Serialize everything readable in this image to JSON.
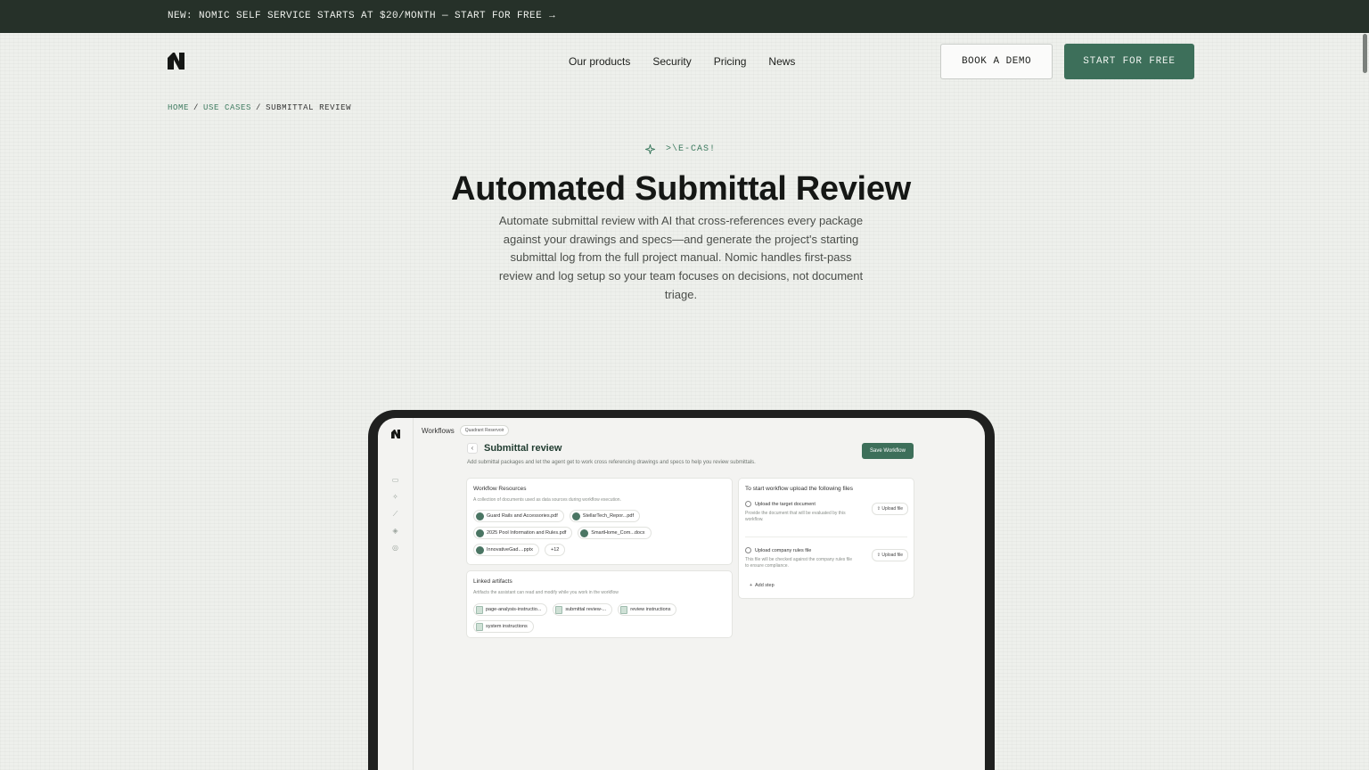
{
  "banner": {
    "text": "NEW: NOMIC SELF SERVICE STARTS AT $20/MONTH — START FOR FREE",
    "arrow": "→"
  },
  "nav": {
    "logo": "nomic-logo",
    "links": [
      "Our products",
      "Security",
      "Pricing",
      "News"
    ],
    "book_demo": "BOOK A DEMO",
    "start_free": "START FOR FREE"
  },
  "breadcrumb": {
    "home": "HOME",
    "sep": "/",
    "use_cases": "USE CASES",
    "current": "SUBMITTAL REVIEW"
  },
  "hero": {
    "eyebrow": ">\\E-CAS!",
    "title": "Automated Submittal Review",
    "subtitle": "Automate submittal review with AI that cross-references every package against your drawings and specs—and generate the project's starting submittal log from the full project manual. Nomic handles first-pass review and log setup so your team focuses on decisions, not document triage."
  },
  "app": {
    "section": "Workflows",
    "org_pill": "Quadrant Reservoir",
    "page_title": "Submittal review",
    "page_desc": "Add submittal packages and let the agent get to work cross referencing drawings and specs to help you review submittals.",
    "save_button": "Save Workflow",
    "resources": {
      "title": "Workflow Resources",
      "desc": "A collection of documents used as data sources during workflow execution.",
      "files": [
        "Guard Rails and Accessories.pdf",
        "StellarTech_Repor...pdf",
        "2025 Pool Information and Rules.pdf",
        "SmartHome_Com...docx",
        "InnovativeGad....pptx"
      ],
      "more": "+12"
    },
    "artifacts": {
      "title": "Linked artifacts",
      "desc": "Artifacts the assistant can read and modify while you work in the workflow",
      "items": [
        "page-analysis-instructio...",
        "submittal review-...",
        "review instructions",
        "system instructions"
      ]
    },
    "start": {
      "title": "To start workflow upload the following files",
      "step1_title": "Upload the target document",
      "step1_desc": "Provide the document that will be evaluated by this workflow.",
      "step2_title": "Upload company rules file",
      "step2_desc": "This file will be checked against the company rules file to ensure compliance.",
      "upload_label": "Upload file",
      "add_step": "Add step"
    }
  },
  "colors": {
    "accent": "#3d6f5a",
    "banner_bg": "#263129",
    "page_bg": "#eef0ec",
    "link": "#3d7a5f"
  }
}
